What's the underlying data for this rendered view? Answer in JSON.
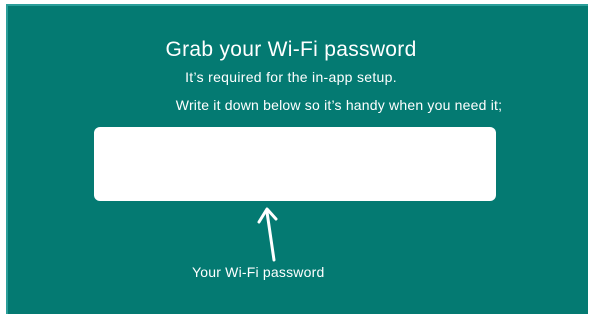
{
  "heading": {
    "title": "Grab your Wi-Fi password",
    "line1": "It’s required for the in-app setup.",
    "line2": "Write it down below so it’s handy when you need it;"
  },
  "password_field": {
    "value": "",
    "label": "Your Wi-Fi password"
  },
  "colors": {
    "background": "#047a72",
    "text": "#ffffff",
    "field": "#ffffff"
  },
  "icons": {
    "pointer": "arrow-up-icon"
  }
}
